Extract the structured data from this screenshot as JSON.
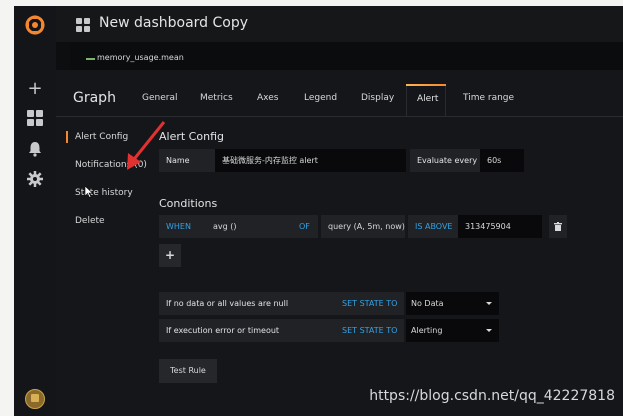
{
  "dashboard": {
    "title": "New dashboard Copy"
  },
  "graph_legend": {
    "series": "memory_usage.mean",
    "color": "#7eb26d"
  },
  "panel": {
    "type_title": "Graph"
  },
  "tabs": [
    {
      "label": "General"
    },
    {
      "label": "Metrics"
    },
    {
      "label": "Axes"
    },
    {
      "label": "Legend"
    },
    {
      "label": "Display"
    },
    {
      "label": "Alert",
      "active": true
    },
    {
      "label": "Time range"
    }
  ],
  "alert_nav": [
    {
      "label": "Alert Config",
      "active": true
    },
    {
      "label": "Notifications (0)"
    },
    {
      "label": "State history"
    },
    {
      "label": "Delete"
    }
  ],
  "alert_config": {
    "title": "Alert Config",
    "name_label": "Name",
    "name_value": "基础微服务-内存监控 alert",
    "evaluate_label": "Evaluate every",
    "evaluate_value": "60s"
  },
  "conditions": {
    "title": "Conditions",
    "when": "WHEN",
    "reducer": "avg ()",
    "of": "OF",
    "query": "query (A, 5m, now)",
    "evaluator": "IS ABOVE",
    "threshold": "313475904",
    "add_icon": "+",
    "delete_icon": "trash-icon"
  },
  "no_data": {
    "label": "If no data or all values are null",
    "set_state": "SET STATE TO",
    "value": "No Data"
  },
  "exec_error": {
    "label": "If execution error or timeout",
    "set_state": "SET STATE TO",
    "value": "Alerting"
  },
  "test_rule_label": "Test Rule",
  "watermark": "https://blog.csdn.net/qq_42227818",
  "colors": {
    "accent": "#f5882f",
    "keyword": "#33a2e5",
    "annotation_arrow": "#e23131"
  }
}
